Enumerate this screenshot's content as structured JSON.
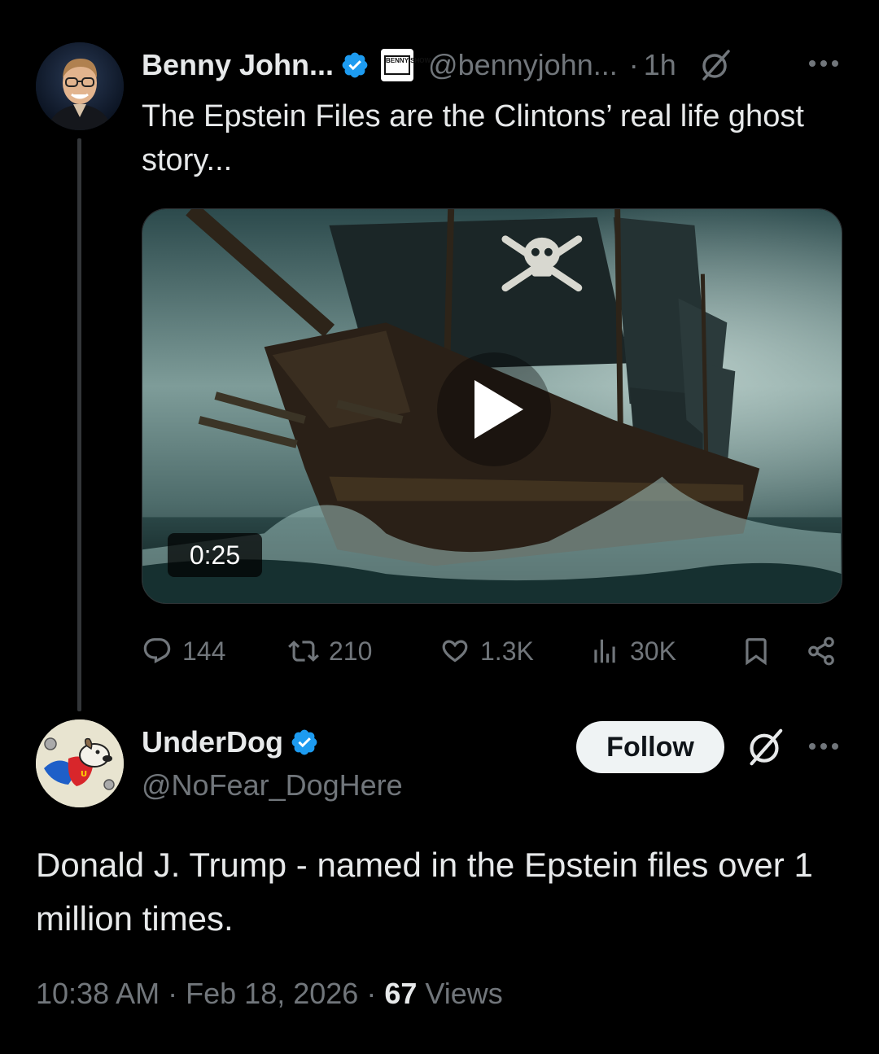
{
  "parent_tweet": {
    "author_name": "Benny John...",
    "affiliate_badge": "BENNY SHOW",
    "handle": "@bennyjohn...",
    "separator": "·",
    "time_ago": "1h",
    "text": "The Epstein Files are the Clintons’ real life ghost story...",
    "video": {
      "duration": "0:25"
    },
    "actions": {
      "replies": "144",
      "reposts": "210",
      "likes": "1.3K",
      "views": "30K"
    }
  },
  "reply_tweet": {
    "author_name": "UnderDog",
    "handle": "@NoFear_DogHere",
    "follow_label": "Follow",
    "text": "Donald J. Trump - named in the Epstein files over 1 million times.",
    "timestamp_time": "10:38 AM",
    "separator": "·",
    "timestamp_date": "Feb 18, 2026",
    "views_count": "67",
    "views_label": "Views"
  },
  "colors": {
    "background": "#000000",
    "text_primary": "#e7e9ea",
    "text_secondary": "#71767b",
    "verified_blue": "#1d9bf0",
    "follow_button_bg": "#eff3f4"
  },
  "icons": [
    "verified-badge-icon",
    "grok-icon",
    "more-icon",
    "play-icon",
    "reply-icon",
    "repost-icon",
    "like-icon",
    "views-icon",
    "bookmark-icon",
    "share-icon"
  ]
}
